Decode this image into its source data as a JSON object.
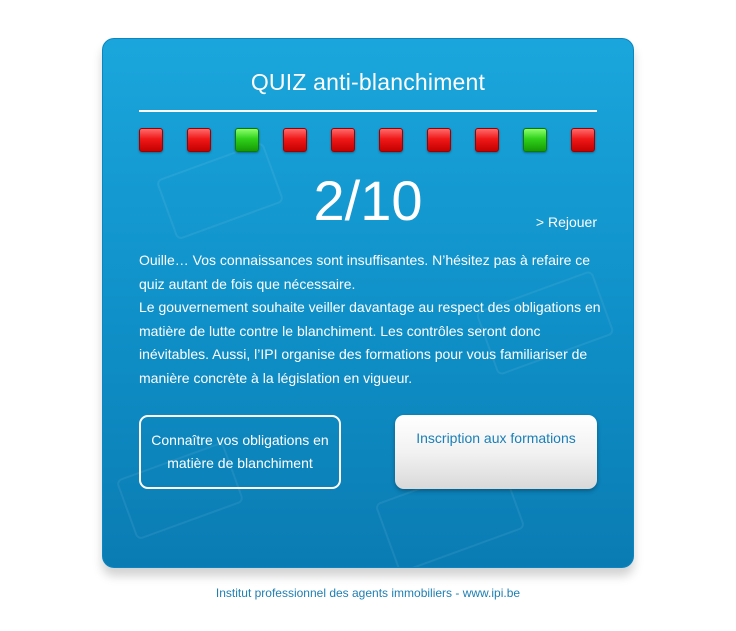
{
  "quiz": {
    "title": "QUIZ anti-blanchiment",
    "answers": [
      "wrong",
      "wrong",
      "correct",
      "wrong",
      "wrong",
      "wrong",
      "wrong",
      "wrong",
      "correct",
      "wrong"
    ],
    "colors": {
      "correct": "#2fd11a",
      "wrong": "#f01818",
      "card": "#1aa6dc",
      "footer": "#1e7fb3"
    },
    "score": "2/10",
    "replay_label": "> Rejouer",
    "message_1": "Ouille… Vos connaissances sont insuffisantes. N’hésitez pas à refaire ce quiz autant de fois que nécessaire.",
    "message_2": "Le gouvernement souhaite veiller davantage au respect des obligations en matière de lutte contre le blanchiment. Les contrôles seront donc inévitables. Aussi, l’IPI organise des formations pour vous familiariser de manière concrète à la législation en vigueur.",
    "buttons": {
      "obligations_label": "Connaître vos obligations en matière de blanchiment",
      "inscription_label": "Inscription aux formations"
    }
  },
  "footer": {
    "text": "Institut professionnel des agents immobiliers - www.ipi.be"
  }
}
